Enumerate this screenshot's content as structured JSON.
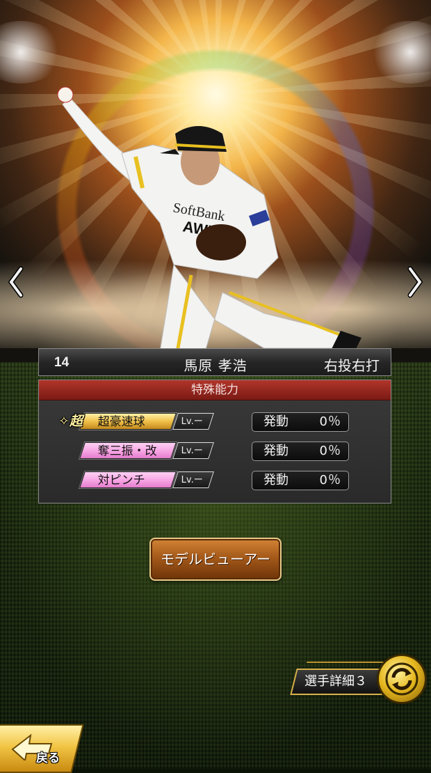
{
  "player": {
    "number": "14",
    "name": "馬原 孝浩",
    "handedness": "右投右打"
  },
  "abilities_panel": {
    "title": "特殊能力",
    "abilities": [
      {
        "badge": "超",
        "name": "超豪速球",
        "level": "Lv.ー",
        "status_label": "発動",
        "rate": "0％",
        "color": "gold"
      },
      {
        "badge": "",
        "name": "奪三振・改",
        "level": "Lv.ー",
        "status_label": "発動",
        "rate": "0％",
        "color": "pink"
      },
      {
        "badge": "",
        "name": "対ピンチ",
        "level": "Lv.ー",
        "status_label": "発動",
        "rate": "0％",
        "color": "pink"
      }
    ]
  },
  "buttons": {
    "model_viewer": "モデルビューアー",
    "player_detail": "選手詳細３",
    "back": "戻る"
  },
  "icons": {
    "prev": "chevron-left-icon",
    "next": "chevron-right-icon",
    "switch": "refresh-arrows-icon",
    "back": "back-arrow-icon"
  },
  "colors": {
    "panel_header": "#9b2a20",
    "gold_tag": "#f0c14a",
    "pink_tag": "#f7a3e3",
    "button_brown": "#a55a1a"
  }
}
